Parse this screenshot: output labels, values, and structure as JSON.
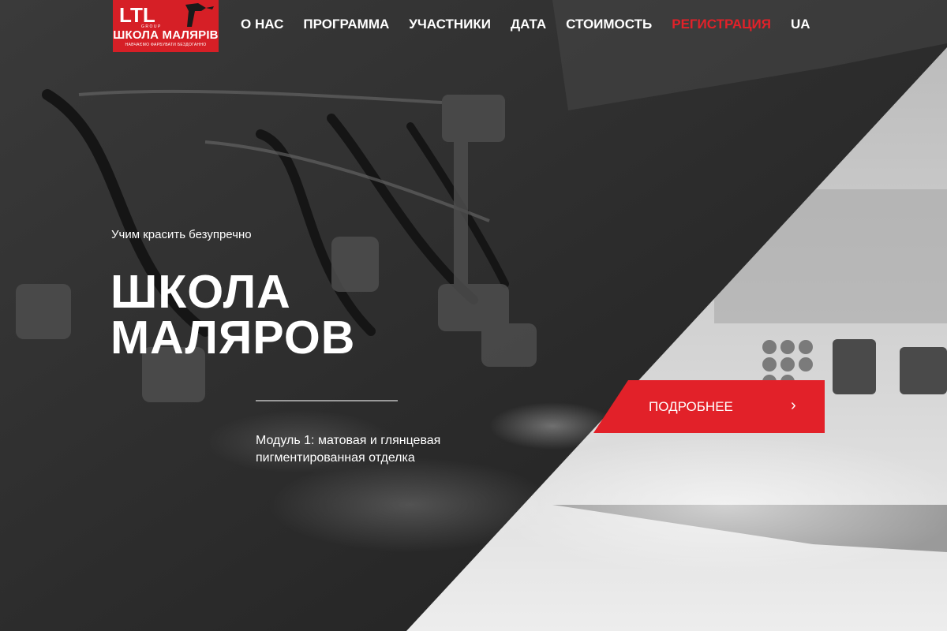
{
  "logo": {
    "mark_text": "LTL",
    "group_text": "GROUP",
    "title": "ШКОЛА МАЛЯРІВ",
    "tagline": "НАВЧАЄМО ФАРБУВАТИ БЕЗДОГАННО"
  },
  "nav": {
    "items": [
      {
        "label": "О НАС"
      },
      {
        "label": "ПРОГРАММА"
      },
      {
        "label": "УЧАСТНИКИ"
      },
      {
        "label": "ДАТА"
      },
      {
        "label": "СТОИМОСТЬ"
      },
      {
        "label": "РЕГИСТРАЦИЯ"
      },
      {
        "label": "UA"
      }
    ],
    "active_index": 5
  },
  "hero": {
    "tagline": "Учим красить безупречно",
    "title_lines": [
      "ШКОЛА",
      "МАЛЯРОВ"
    ],
    "module_lines": [
      "Модуль 1: матовая и глянцевая",
      "пигментированная отделка"
    ],
    "cta_label": "ПОДРОБНЕЕ",
    "cta_icon": "chevron-right-icon",
    "cta_icon_glyph": "›"
  },
  "colors": {
    "accent": "#e22129",
    "logo_background": "#d61f26",
    "text": "#ffffff",
    "dark_overlay": "#2b2b2b",
    "light_panel": "#c9c9c9"
  }
}
